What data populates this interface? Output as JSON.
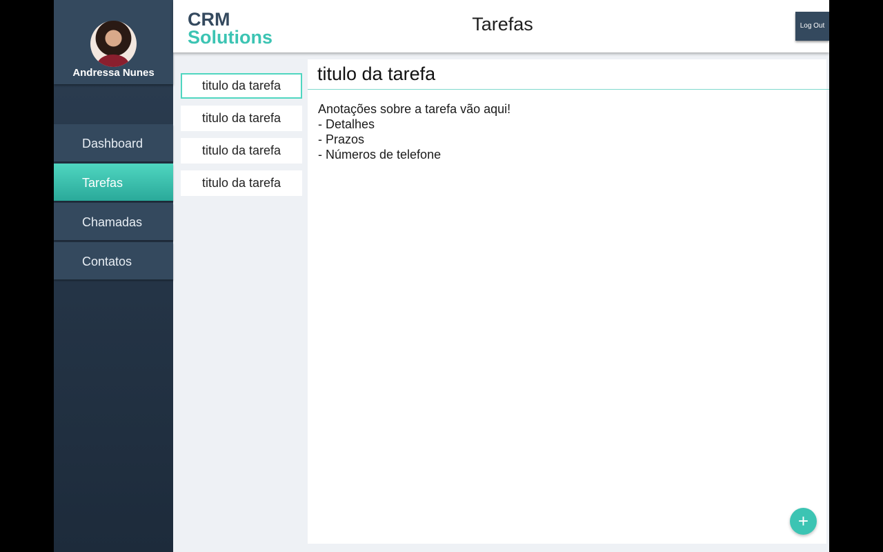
{
  "user": {
    "name": "Andressa Nunes"
  },
  "nav": {
    "items": [
      {
        "label": "Dashboard"
      },
      {
        "label": "Tarefas"
      },
      {
        "label": "Chamadas"
      },
      {
        "label": "Contatos"
      }
    ],
    "active": "Tarefas"
  },
  "header": {
    "logo_top": "CRM",
    "logo_bottom": "Solutions",
    "title": "Tarefas",
    "logout_label": "Log Out"
  },
  "tasks": [
    {
      "title": "titulo da tarefa",
      "selected": true
    },
    {
      "title": "titulo da tarefa"
    },
    {
      "title": "titulo da tarefa"
    },
    {
      "title": "titulo da tarefa"
    }
  ],
  "detail": {
    "title": "titulo da tarefa",
    "notes": [
      "Anotações sobre a tarefa vão aqui!",
      "- Detalhes",
      "- Prazos",
      "- Números de telefone"
    ]
  },
  "fab": {
    "symbol": "+"
  },
  "colors": {
    "accent": "#3cc4b3",
    "sidebar": "#34495e",
    "sidebar_dark": "#1d2b3b",
    "background": "#eef1f5"
  },
  "icons": {
    "fab": "plus-icon"
  }
}
